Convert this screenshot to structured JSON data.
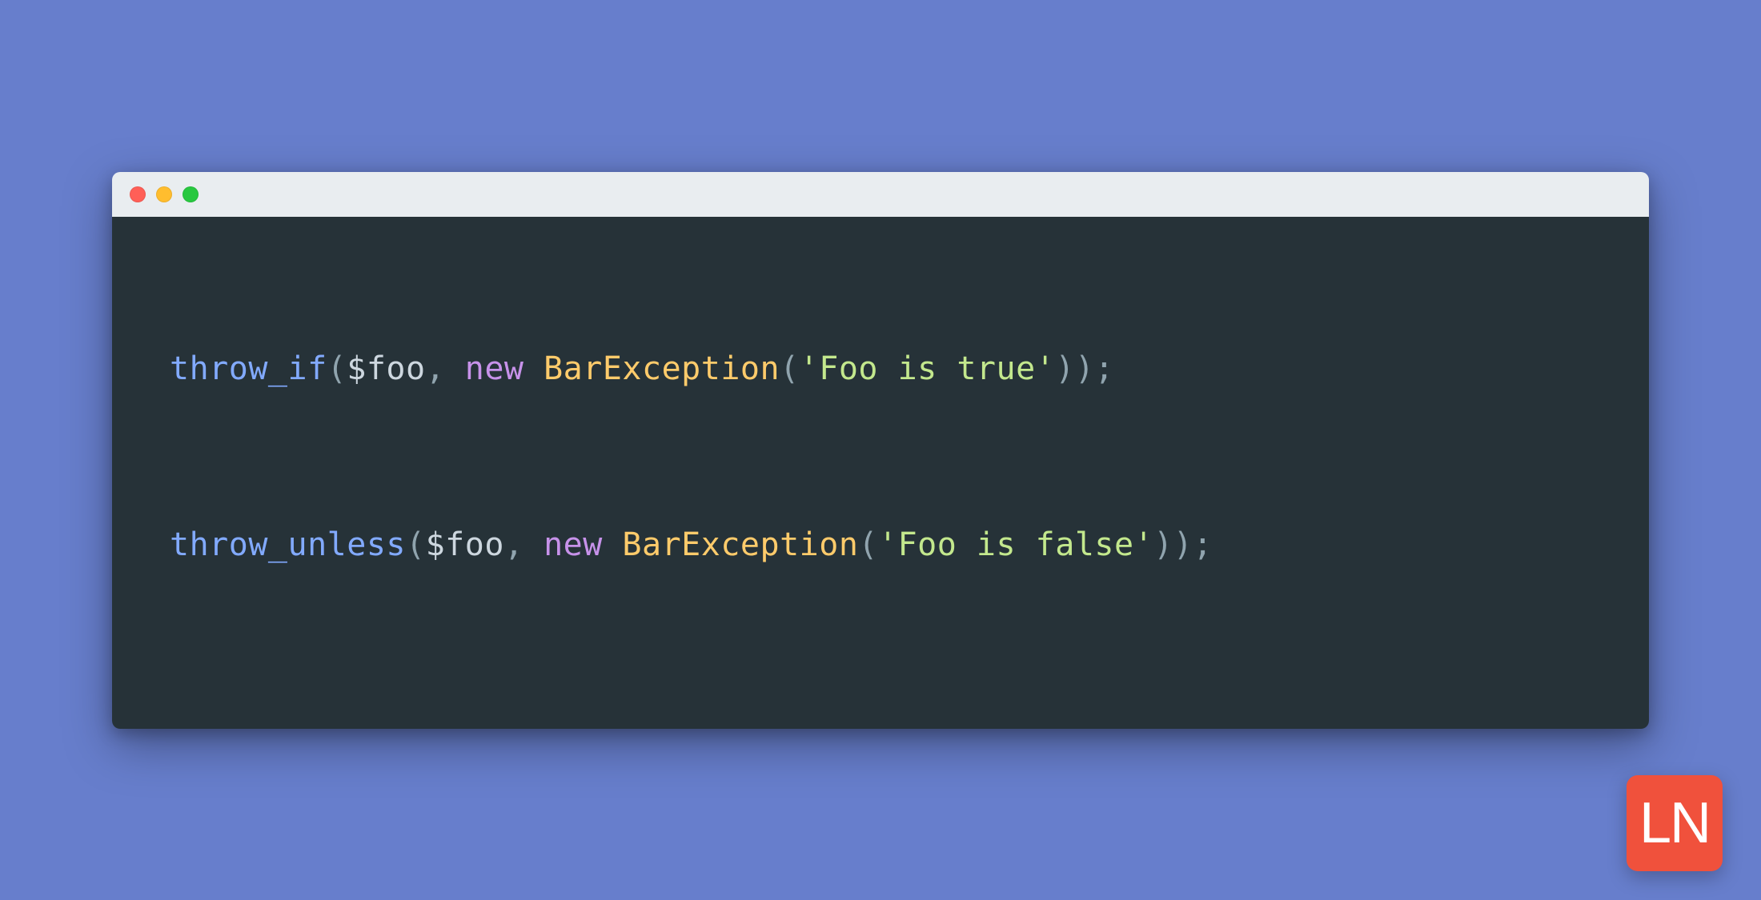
{
  "colors": {
    "background": "#677ecc",
    "titlebar": "#e9edf0",
    "editor_bg": "#263238",
    "traffic_red": "#ff5f57",
    "traffic_yellow": "#ffbd2e",
    "traffic_green": "#28c840",
    "badge_bg": "#f0513c",
    "tok_fn": "#82aaff",
    "tok_punc": "#90a4ae",
    "tok_var": "#cdd7df",
    "tok_key": "#c792ea",
    "tok_class": "#ffcb6b",
    "tok_str": "#c3e88d"
  },
  "badge": {
    "text": "LN"
  },
  "code": {
    "line1": {
      "fn": "throw_if",
      "open": "(",
      "var": "$foo",
      "comma": ", ",
      "key": "new",
      "space": " ",
      "class": "BarException",
      "open2": "(",
      "str": "'Foo is true'",
      "close": "));"
    },
    "line2": {
      "fn": "throw_unless",
      "open": "(",
      "var": "$foo",
      "comma": ", ",
      "key": "new",
      "space": " ",
      "class": "BarException",
      "open2": "(",
      "str": "'Foo is false'",
      "close": "));"
    }
  }
}
